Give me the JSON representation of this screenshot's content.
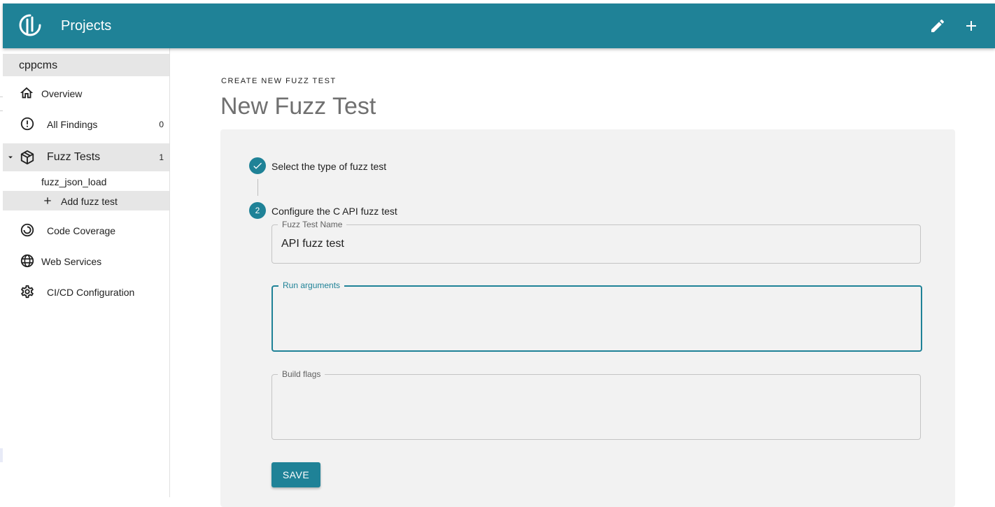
{
  "appbar": {
    "title": "Projects",
    "accent": "#1f8297",
    "icons": [
      "logo-icon",
      "edit-icon",
      "add-icon"
    ]
  },
  "sidebar": {
    "project": "cppcms",
    "items": [
      {
        "label": "Overview",
        "icon": "home-icon"
      },
      {
        "label": "All Findings",
        "icon": "alert-circle-icon",
        "count": "0"
      },
      {
        "label": "Fuzz Tests",
        "icon": "package-icon",
        "count": "1",
        "expanded": true
      },
      {
        "label": "fuzz_json_load"
      },
      {
        "label": "Add fuzz test",
        "icon": "plus-icon"
      },
      {
        "label": "Code Coverage",
        "icon": "coverage-icon"
      },
      {
        "label": "Web Services",
        "icon": "globe-icon"
      },
      {
        "label": "CI/CD Configuration",
        "icon": "gear-icon"
      }
    ]
  },
  "main": {
    "overline": "CREATE NEW FUZZ TEST",
    "title": "New Fuzz Test",
    "steps": [
      {
        "label": "Select the type of fuzz test",
        "status": "complete"
      },
      {
        "label": "Configure the C API fuzz test",
        "number": "2",
        "status": "active"
      }
    ],
    "fields": {
      "name": {
        "label": "Fuzz Test Name",
        "value": "API fuzz test"
      },
      "run_args": {
        "label": "Run arguments",
        "value": ""
      },
      "build_flags": {
        "label": "Build flags",
        "value": ""
      }
    },
    "save_label": "SAVE"
  }
}
